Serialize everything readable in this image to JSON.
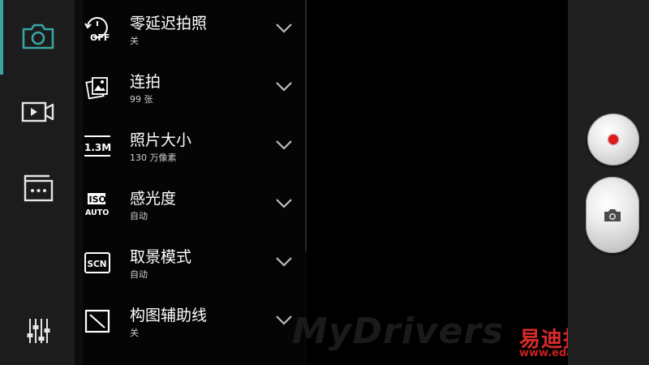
{
  "left_rail": {
    "items": [
      {
        "icon": "camera-icon",
        "active": true
      },
      {
        "icon": "video-icon",
        "active": false
      },
      {
        "icon": "more-modes-icon",
        "active": false
      }
    ],
    "bottom_icon": "settings-sliders-icon",
    "accent_color": "#3aa3a3"
  },
  "settings": {
    "items": [
      {
        "icon": "zero-shutter-lag-icon",
        "icon_text": "OFF",
        "title": "零延迟拍照",
        "value": "关"
      },
      {
        "icon": "burst-icon",
        "title": "连拍",
        "value": "99 张"
      },
      {
        "icon": "photo-size-icon",
        "icon_text": "1.3M",
        "title": "照片大小",
        "value": "130 万像素"
      },
      {
        "icon": "iso-icon",
        "icon_text": "ISO",
        "icon_text2": "AUTO",
        "title": "感光度",
        "value": "自动"
      },
      {
        "icon": "scene-mode-icon",
        "icon_text": "SCN",
        "title": "取景模式",
        "value": "自动"
      },
      {
        "icon": "grid-lines-icon",
        "title": "构图辅助线",
        "value": "关"
      }
    ]
  },
  "controls": {
    "video_record_color": "#e01a1a",
    "shutter_icon": "camera-icon"
  },
  "watermark": {
    "text": "MyDrivers",
    "text_cn": "易迪拓培训",
    "url": "www.edatop.com"
  }
}
